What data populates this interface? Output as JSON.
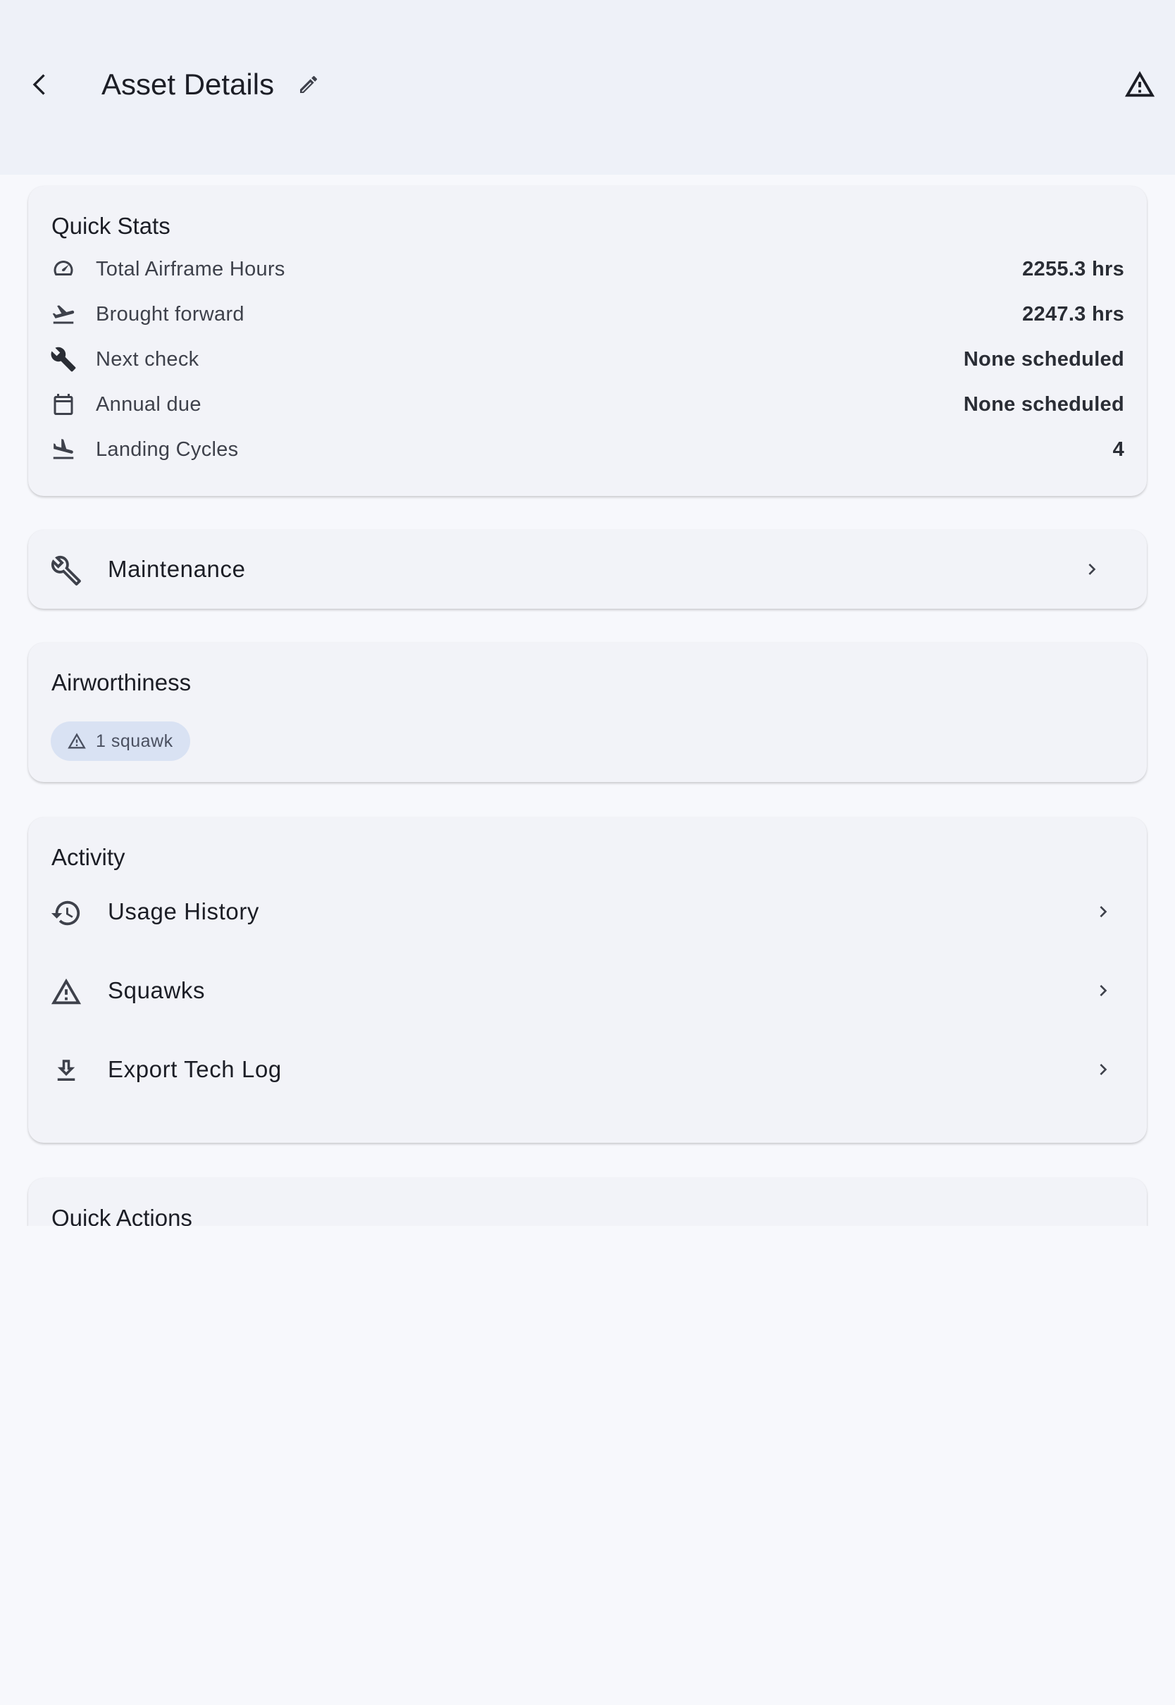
{
  "app_bar": {
    "title": "Asset Details",
    "back_icon": "chevron-left-icon",
    "edit_icon": "pencil-icon",
    "alert_icon": "warning-triangle-icon"
  },
  "quick_stats": {
    "title": "Quick Stats",
    "rows": [
      {
        "icon": "speedometer-icon",
        "label": "Total Airframe Hours",
        "value": "2255.3 hrs"
      },
      {
        "icon": "airplane-takeoff-icon",
        "label": "Brought forward",
        "value": "2247.3 hrs"
      },
      {
        "icon": "wrench-icon",
        "label": "Next check",
        "value": "None scheduled"
      },
      {
        "icon": "calendar-icon",
        "label": "Annual due",
        "value": "None scheduled"
      },
      {
        "icon": "airplane-landing-icon",
        "label": "Landing Cycles",
        "value": "4"
      }
    ]
  },
  "maintenance": {
    "label": "Maintenance",
    "icon": "wrench-outline-icon"
  },
  "airworthiness": {
    "title": "Airworthiness",
    "chip_label": "1 squawk",
    "chip_icon": "warning-triangle-icon",
    "chip_color": "#d9e2f3"
  },
  "activity": {
    "title": "Activity",
    "items": [
      {
        "icon": "history-icon",
        "label": "Usage History"
      },
      {
        "icon": "warning-triangle-icon",
        "label": "Squawks"
      },
      {
        "icon": "download-icon",
        "label": "Export Tech Log"
      }
    ]
  },
  "quick_actions": {
    "title": "Quick Actions"
  },
  "colors": {
    "app_bar_bg": "#eef1f8",
    "card_bg": "#f2f3f8",
    "page_bg": "#f7f8fc",
    "text_primary": "#1c1e26",
    "text_secondary": "#3e414b"
  }
}
